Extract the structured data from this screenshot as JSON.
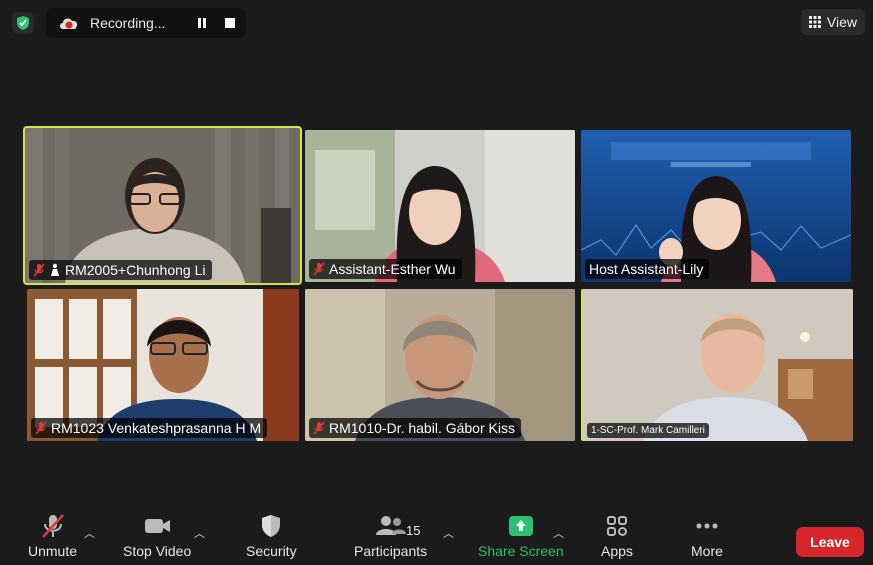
{
  "recording": {
    "label": "Recording..."
  },
  "view": {
    "label": "View"
  },
  "tiles": [
    {
      "name": "RM2005+Chunhong Li"
    },
    {
      "name": "Assistant-Esther Wu"
    },
    {
      "name": "Host Assistant-Lily"
    },
    {
      "name": "RM1023 Venkateshprasanna H M"
    },
    {
      "name": "RM1010-Dr. habil. Gábor Kiss"
    },
    {
      "name": "1-SC-Prof. Mark Camilleri"
    }
  ],
  "toolbar": {
    "unmute": "Unmute",
    "stop_video": "Stop Video",
    "security": "Security",
    "participants": "Participants",
    "participants_count": "15",
    "share_screen": "Share Screen",
    "apps": "Apps",
    "more": "More",
    "leave": "Leave"
  },
  "colors": {
    "accent_green": "#2fbf71",
    "leave_red": "#d6262b",
    "active_speaker": "#d7e24a"
  }
}
